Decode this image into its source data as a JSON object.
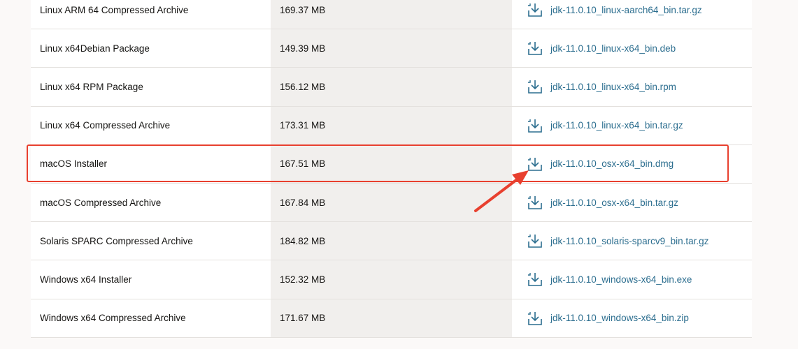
{
  "rows": [
    {
      "product": "Linux ARM 64 Compressed Archive",
      "size": "169.37 MB",
      "file": "jdk-11.0.10_linux-aarch64_bin.tar.gz"
    },
    {
      "product": "Linux x64Debian Package",
      "size": "149.39 MB",
      "file": "jdk-11.0.10_linux-x64_bin.deb"
    },
    {
      "product": "Linux x64 RPM Package",
      "size": "156.12 MB",
      "file": "jdk-11.0.10_linux-x64_bin.rpm"
    },
    {
      "product": "Linux x64 Compressed Archive",
      "size": "173.31 MB",
      "file": "jdk-11.0.10_linux-x64_bin.tar.gz"
    },
    {
      "product": "macOS Installer",
      "size": "167.51 MB",
      "file": "jdk-11.0.10_osx-x64_bin.dmg"
    },
    {
      "product": "macOS Compressed Archive",
      "size": "167.84 MB",
      "file": "jdk-11.0.10_osx-x64_bin.tar.gz"
    },
    {
      "product": "Solaris SPARC Compressed Archive",
      "size": "184.82 MB",
      "file": "jdk-11.0.10_solaris-sparcv9_bin.tar.gz"
    },
    {
      "product": "Windows x64 Installer",
      "size": "152.32 MB",
      "file": "jdk-11.0.10_windows-x64_bin.exe"
    },
    {
      "product": "Windows x64 Compressed Archive",
      "size": "171.67 MB",
      "file": "jdk-11.0.10_windows-x64_bin.zip"
    }
  ],
  "highlighted_row": 4,
  "icon": "download-icon",
  "colors": {
    "link": "#2c6e8f",
    "highlight": "#e8402f",
    "size_column_bg": "#f1efed",
    "page_bg": "#fbf9f8"
  }
}
